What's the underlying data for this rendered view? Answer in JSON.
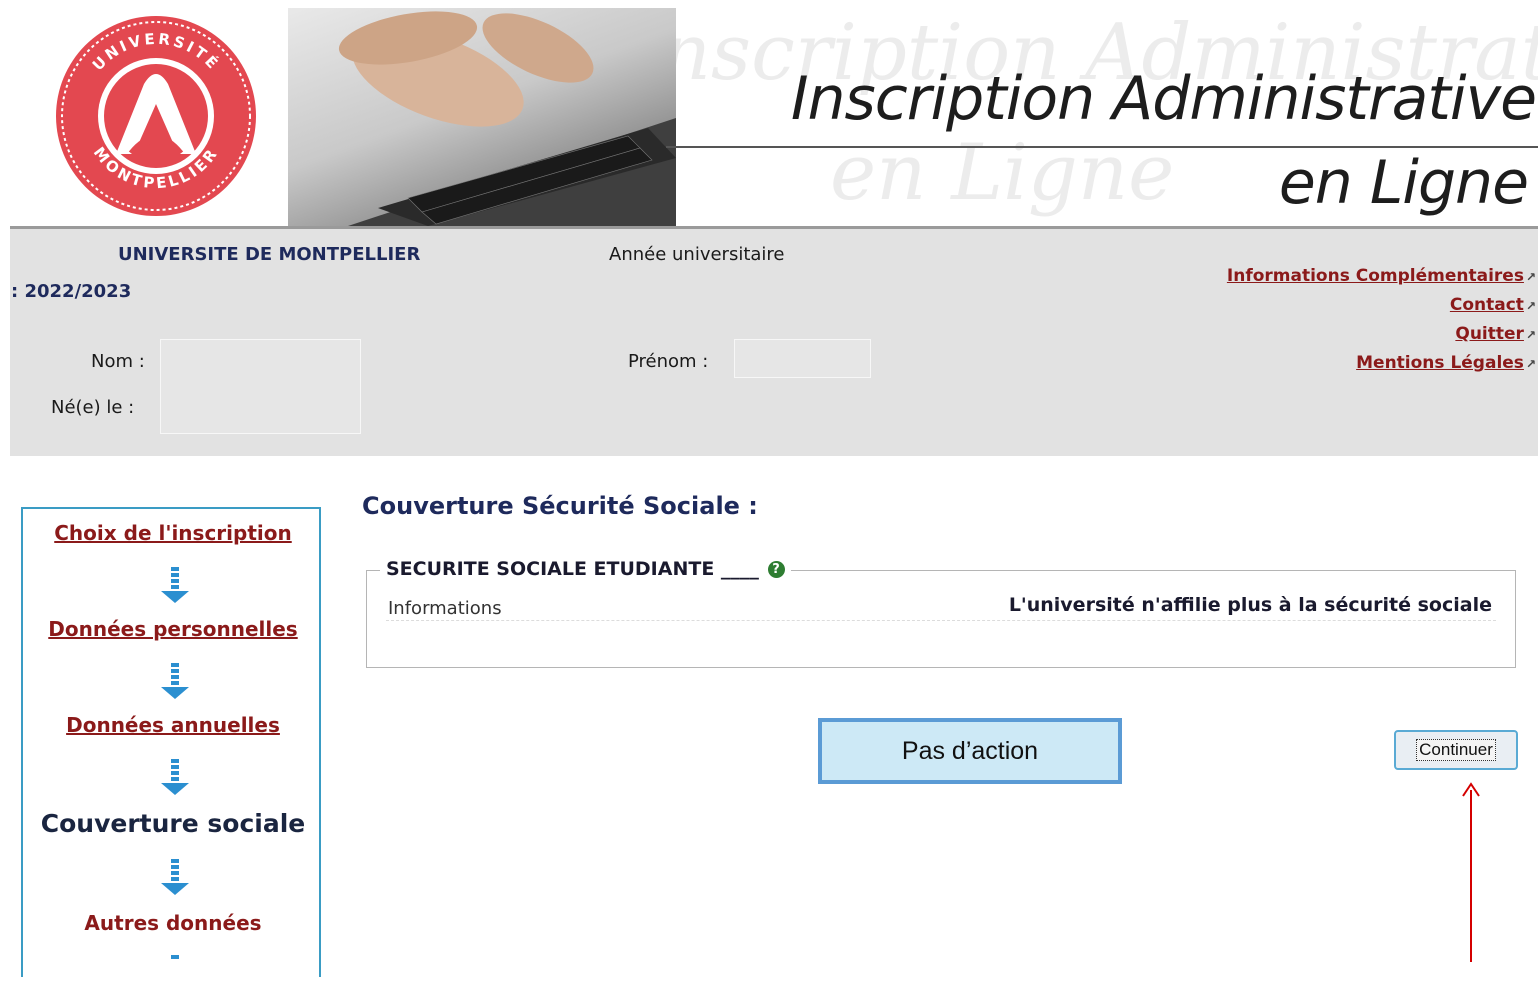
{
  "banner": {
    "title_line1": "Inscription Administrative",
    "title_line2": "en Ligne",
    "seal_top_text": "UNIVERSITÉ",
    "seal_bottom_text": "MONTPELLIER"
  },
  "header": {
    "university": "UNIVERSITE DE MONTPELLIER",
    "year_label": "Année universitaire",
    "year_value": ": 2022/2023",
    "nom_label": "Nom :",
    "prenom_label": "Prénom :",
    "ne_le_label": "Né(e) le :",
    "nom_value": "",
    "prenom_value": "",
    "ne_le_value": ""
  },
  "top_links": [
    {
      "label": "Informations Complémentaires"
    },
    {
      "label": "Contact"
    },
    {
      "label": "Quitter"
    },
    {
      "label": "Mentions Légales"
    }
  ],
  "sidebar": {
    "steps": [
      {
        "label": "Choix de l'inscription",
        "state": "done"
      },
      {
        "label": "Données personnelles",
        "state": "done"
      },
      {
        "label": "Données annuelles",
        "state": "done"
      },
      {
        "label": "Couverture sociale",
        "state": "current"
      },
      {
        "label": "Autres données",
        "state": "next"
      }
    ]
  },
  "main": {
    "section_title": "Couverture Sécurité Sociale :",
    "fieldset_legend": "SECURITE SOCIALE ETUDIANTE ____",
    "info_label": "Informations",
    "info_value": "L'université n'affilie plus à la sécurité sociale",
    "continue_label": "Continuer"
  },
  "annotation": {
    "note": "Pas d’action",
    "arrow_color": "#d40000"
  },
  "colors": {
    "link_red": "#8b1a1a",
    "navy": "#1e2a5c",
    "sidebar_border": "#3a9cc4",
    "note_fill": "#cde9f6",
    "note_border": "#5b9bd5"
  }
}
